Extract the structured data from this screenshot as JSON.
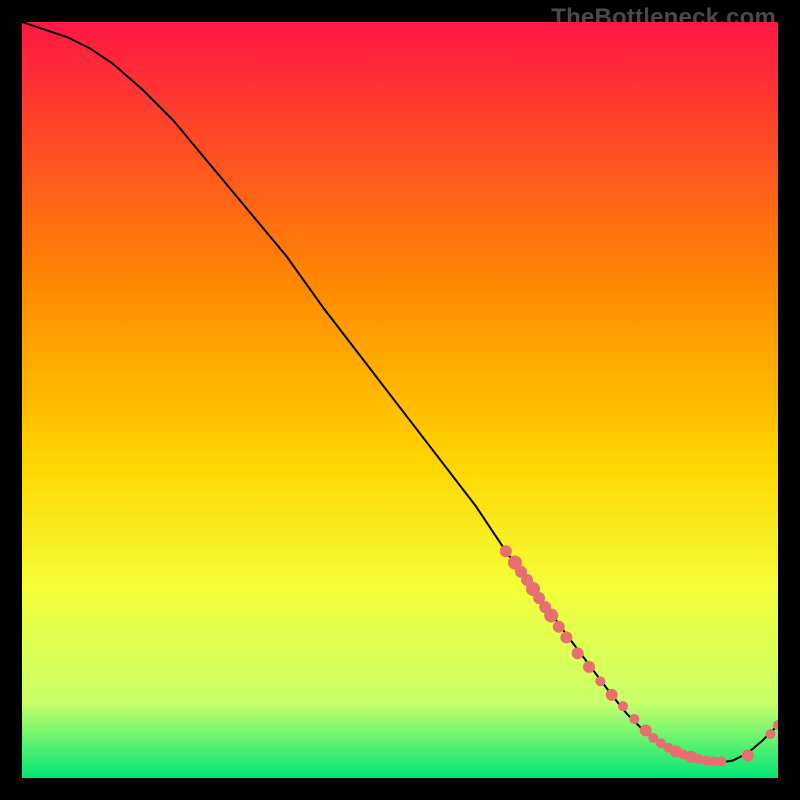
{
  "watermark": "TheBottleneck.com",
  "colors": {
    "marker": "#e76f6f",
    "line": "#000000",
    "gradient_top": "#ff1744",
    "gradient_upper_mid": "#ff8a00",
    "gradient_mid": "#ffd400",
    "gradient_lower_mid": "#f4ff3a",
    "gradient_low": "#c8ff6a",
    "gradient_bottom": "#00e676"
  },
  "chart_data": {
    "type": "line",
    "title": "",
    "xlabel": "",
    "ylabel": "",
    "xlim": [
      0,
      100
    ],
    "ylim": [
      0,
      100
    ],
    "grid": false,
    "legend": null,
    "series": [
      {
        "name": "curve",
        "x": [
          0,
          3,
          6,
          9,
          12,
          16,
          20,
          25,
          30,
          35,
          40,
          45,
          50,
          55,
          60,
          64,
          68,
          72,
          75,
          78,
          80,
          82,
          84,
          86,
          88,
          90,
          92,
          94,
          96,
          98,
          100
        ],
        "y": [
          100,
          99,
          98,
          96.5,
          94.5,
          91,
          87,
          81,
          75,
          69,
          62,
          55.5,
          49,
          42.5,
          36,
          30,
          24.5,
          19,
          15,
          11,
          8.5,
          6.5,
          5,
          3.8,
          2.8,
          2.2,
          2,
          2.3,
          3.3,
          5,
          7
        ]
      }
    ],
    "markers": [
      {
        "x": 64.0,
        "y": 30.0,
        "r": 6
      },
      {
        "x": 65.2,
        "y": 28.5,
        "r": 7
      },
      {
        "x": 66.0,
        "y": 27.3,
        "r": 6
      },
      {
        "x": 66.8,
        "y": 26.2,
        "r": 6
      },
      {
        "x": 67.6,
        "y": 25.0,
        "r": 7
      },
      {
        "x": 68.4,
        "y": 23.8,
        "r": 6
      },
      {
        "x": 69.2,
        "y": 22.6,
        "r": 6
      },
      {
        "x": 70.0,
        "y": 21.5,
        "r": 7
      },
      {
        "x": 71.0,
        "y": 20.0,
        "r": 6
      },
      {
        "x": 72.0,
        "y": 18.6,
        "r": 6
      },
      {
        "x": 73.5,
        "y": 16.5,
        "r": 6
      },
      {
        "x": 75.0,
        "y": 14.7,
        "r": 6
      },
      {
        "x": 76.5,
        "y": 12.8,
        "r": 5
      },
      {
        "x": 78.0,
        "y": 11.0,
        "r": 6
      },
      {
        "x": 79.5,
        "y": 9.5,
        "r": 5
      },
      {
        "x": 81.0,
        "y": 7.8,
        "r": 5
      },
      {
        "x": 82.5,
        "y": 6.3,
        "r": 6
      },
      {
        "x": 83.5,
        "y": 5.3,
        "r": 5
      },
      {
        "x": 84.5,
        "y": 4.6,
        "r": 5
      },
      {
        "x": 85.5,
        "y": 4.0,
        "r": 5
      },
      {
        "x": 86.5,
        "y": 3.5,
        "r": 6
      },
      {
        "x": 87.5,
        "y": 3.1,
        "r": 5
      },
      {
        "x": 88.5,
        "y": 2.8,
        "r": 6
      },
      {
        "x": 89.5,
        "y": 2.5,
        "r": 5
      },
      {
        "x": 90.5,
        "y": 2.3,
        "r": 5
      },
      {
        "x": 91.5,
        "y": 2.2,
        "r": 5
      },
      {
        "x": 92.5,
        "y": 2.2,
        "r": 5
      },
      {
        "x": 96.0,
        "y": 3.0,
        "r": 6
      },
      {
        "x": 99.0,
        "y": 5.8,
        "r": 5
      },
      {
        "x": 100.0,
        "y": 7.0,
        "r": 5
      }
    ]
  }
}
